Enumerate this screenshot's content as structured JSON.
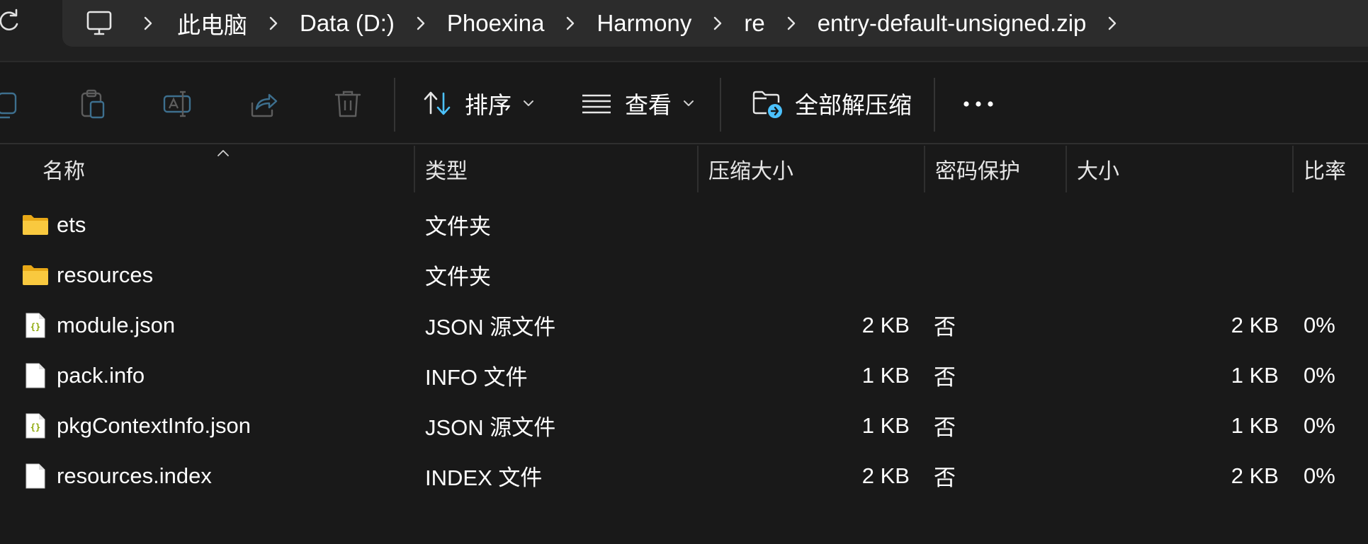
{
  "breadcrumb": {
    "items": [
      "此电脑",
      "Data (D:)",
      "Phoexina",
      "Harmony",
      "re",
      "entry-default-unsigned.zip"
    ]
  },
  "toolbar": {
    "sort_label": "排序",
    "view_label": "查看",
    "extract_all_label": "全部解压缩"
  },
  "columns": {
    "name": "名称",
    "type": "类型",
    "compressed_size": "压缩大小",
    "password": "密码保护",
    "size": "大小",
    "ratio": "比率"
  },
  "files": [
    {
      "name": "ets",
      "type": "文件夹",
      "compressed_size": "",
      "password": "",
      "size": "",
      "ratio": "",
      "icon": "folder-icon"
    },
    {
      "name": "resources",
      "type": "文件夹",
      "compressed_size": "",
      "password": "",
      "size": "",
      "ratio": "",
      "icon": "folder-icon"
    },
    {
      "name": "module.json",
      "type": "JSON 源文件",
      "compressed_size": "2 KB",
      "password": "否",
      "size": "2 KB",
      "ratio": "0%",
      "icon": "json-file-icon"
    },
    {
      "name": "pack.info",
      "type": "INFO 文件",
      "compressed_size": "1 KB",
      "password": "否",
      "size": "1 KB",
      "ratio": "0%",
      "icon": "file-icon"
    },
    {
      "name": "pkgContextInfo.json",
      "type": "JSON 源文件",
      "compressed_size": "1 KB",
      "password": "否",
      "size": "1 KB",
      "ratio": "0%",
      "icon": "json-file-icon"
    },
    {
      "name": "resources.index",
      "type": "INDEX 文件",
      "compressed_size": "2 KB",
      "password": "否",
      "size": "2 KB",
      "ratio": "0%",
      "icon": "file-icon"
    }
  ],
  "colors": {
    "background": "#191919",
    "address_bar": "#2c2c2c",
    "folder": "#f9c93f",
    "accent": "#4cc2ff",
    "disabled_icon": "#5d5d5d"
  }
}
